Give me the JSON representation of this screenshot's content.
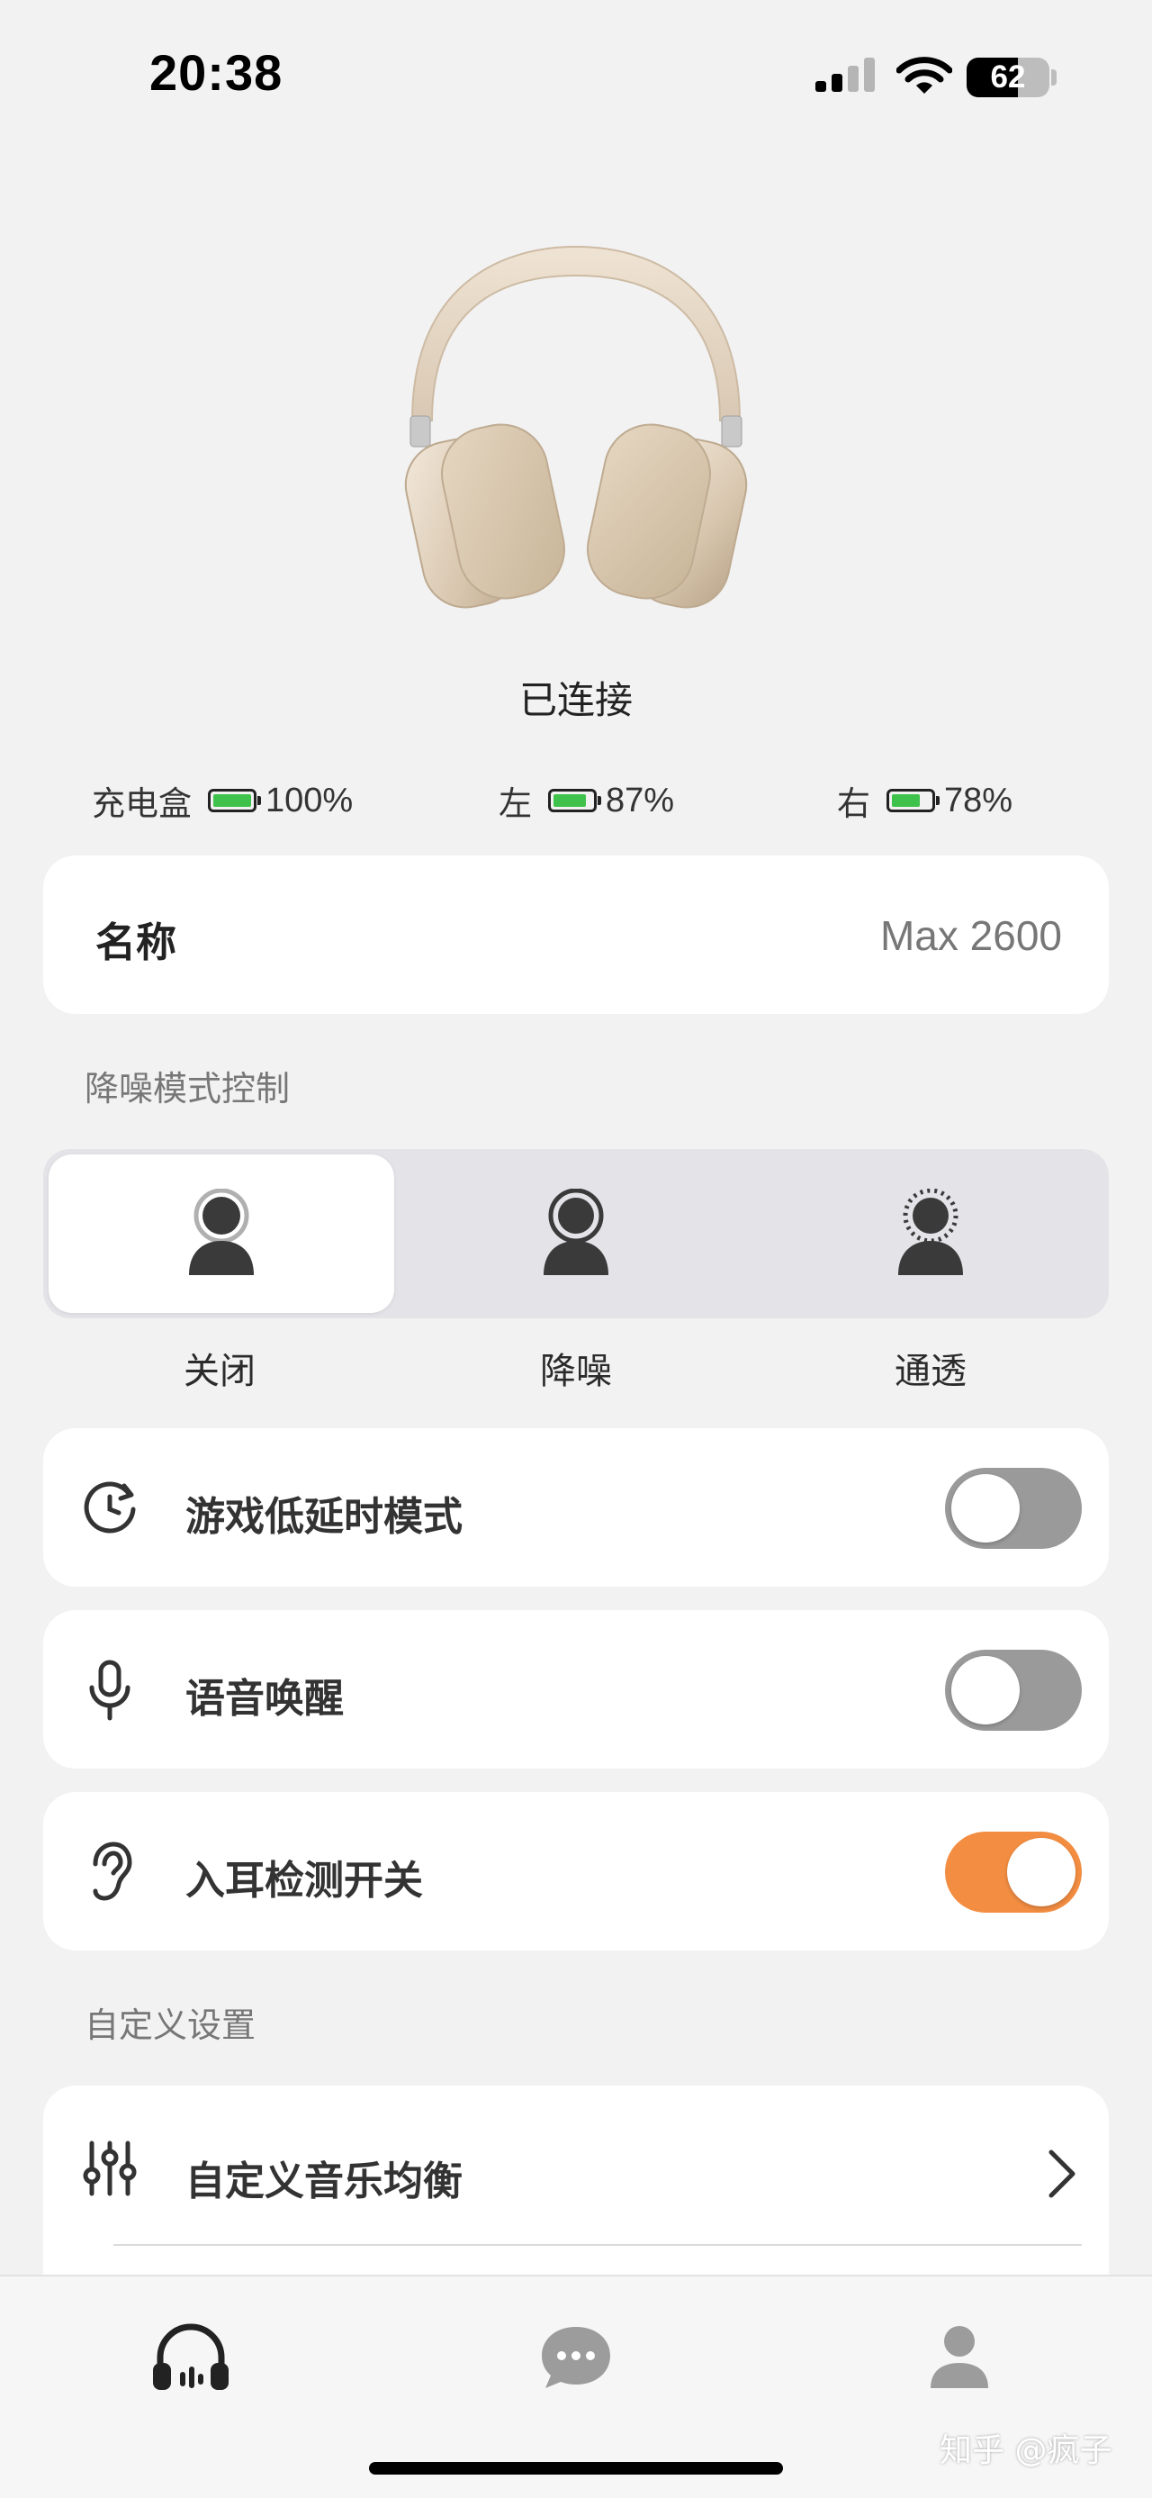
{
  "status_bar": {
    "time": "20:38",
    "battery_level": 62,
    "battery_text": "62"
  },
  "device": {
    "image": "headphones-image",
    "connection_status": "已连接"
  },
  "batteries": [
    {
      "label": "充电盒",
      "percent_text": "100%",
      "level": 1.0
    },
    {
      "label": "左",
      "percent_text": "87%",
      "level": 0.87
    },
    {
      "label": "右",
      "percent_text": "78%",
      "level": 0.78
    }
  ],
  "name_row": {
    "label": "名称",
    "value": "Max 2600"
  },
  "anc": {
    "section_title": "降噪模式控制",
    "options": [
      {
        "label": "关闭",
        "icon": "person-off-icon",
        "selected": true
      },
      {
        "label": "降噪",
        "icon": "person-anc-icon",
        "selected": false
      },
      {
        "label": "通透",
        "icon": "person-transparency-icon",
        "selected": false
      }
    ]
  },
  "toggles": [
    {
      "label": "游戏低延时模式",
      "icon": "clock-refresh-icon",
      "on": false
    },
    {
      "label": "语音唤醒",
      "icon": "microphone-icon",
      "on": false
    },
    {
      "label": "入耳检测开关",
      "icon": "ear-icon",
      "on": true
    }
  ],
  "custom_settings": {
    "section_title": "自定义设置",
    "eq_label": "自定义音乐均衡",
    "icon": "equalizer-sliders-icon"
  },
  "tab_bar": {
    "tabs": [
      {
        "icon": "headphones-tab-icon",
        "active": true
      },
      {
        "icon": "chat-bubble-icon",
        "active": false
      },
      {
        "icon": "profile-icon",
        "active": false
      }
    ]
  },
  "watermark": "知乎 @疯子",
  "colors": {
    "accent_orange": "#f28d42",
    "battery_green": "#3fc24b",
    "toggle_off_gray": "#9a9a9a",
    "background": "#f2f2f2"
  }
}
